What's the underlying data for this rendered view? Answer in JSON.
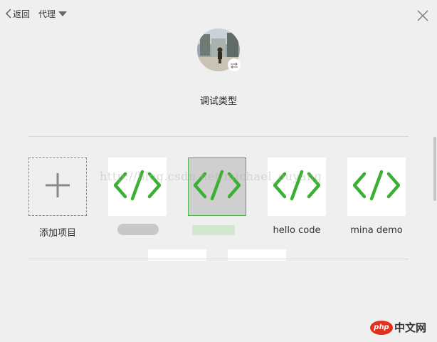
{
  "header": {
    "back_label": "返回",
    "proxy_label": "代理"
  },
  "title": "调试类型",
  "projects": [
    {
      "label": "添加项目",
      "kind": "add"
    },
    {
      "label": "",
      "kind": "code",
      "state": "normal"
    },
    {
      "label": "",
      "kind": "code",
      "state": "selected"
    },
    {
      "label": "hello code",
      "kind": "code",
      "state": "normal"
    },
    {
      "label": "mina demo",
      "kind": "code",
      "state": "normal"
    }
  ],
  "watermark": "http://blog.csdn.net/michael_ouyang",
  "logo": {
    "badge": "php",
    "text": "中文网"
  },
  "colors": {
    "background": "#efefef",
    "code_icon_green": "#3cb034",
    "selected_border": "#4caf50",
    "php_badge": "#e0301e"
  },
  "icons": [
    "back-chevron-icon",
    "dropdown-caret-icon",
    "close-icon",
    "switch-icon",
    "plus-icon",
    "code-icon"
  ]
}
